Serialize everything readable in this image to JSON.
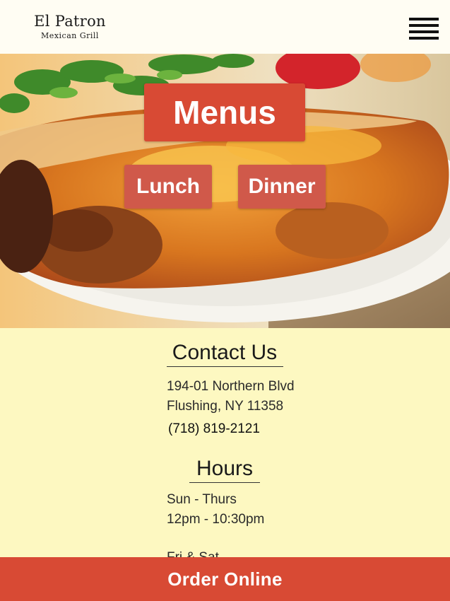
{
  "header": {
    "logo_title": "El Patron",
    "logo_subtitle": "Mexican Grill",
    "menu_icon": "hamburger-menu-icon"
  },
  "hero": {
    "title": "Menus",
    "buttons": [
      "Lunch",
      "Dinner"
    ]
  },
  "contact": {
    "heading": "Contact Us",
    "address_line1": "194-01 Northern Blvd",
    "address_line2": "Flushing, NY 11358",
    "phone": "(718) 819-2121"
  },
  "hours": {
    "heading": "Hours",
    "days1": "Sun - Thurs",
    "time1": "12pm - 10:30pm",
    "days2": "Fri & Sat"
  },
  "footer": {
    "order_label": "Order Online"
  },
  "colors": {
    "accent": "#d84a34",
    "button": "#d0594a",
    "page_background": "#fdf8c1",
    "header_background": "#fffdf3"
  }
}
